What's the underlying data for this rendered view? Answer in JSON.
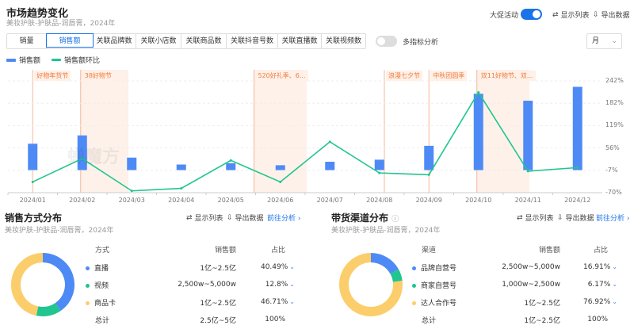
{
  "header": {
    "title": "市场趋势变化",
    "subtitle": "美妆护肤-护肤品-润唇膏，2024年",
    "promo_toggle_label": "大促活动",
    "promo_on": true,
    "show_list": "显示列表",
    "export": "导出数据"
  },
  "tabs": [
    {
      "label": "销量",
      "active": false
    },
    {
      "label": "销售额",
      "active": true
    },
    {
      "label": "关联品牌数",
      "active": false
    },
    {
      "label": "关联小店数",
      "active": false
    },
    {
      "label": "关联商品数",
      "active": false
    },
    {
      "label": "关联抖音号数",
      "active": false
    },
    {
      "label": "关联直播数",
      "active": false
    },
    {
      "label": "关联视频数",
      "active": false
    }
  ],
  "multi_metric": {
    "label": "多指标分析",
    "on": false
  },
  "period_select": "月",
  "watermark": "蝉魔方",
  "chart_data": {
    "type": "bar+line",
    "x": [
      "2024/01",
      "2024/02",
      "2024/03",
      "2024/04",
      "2024/05",
      "2024/06",
      "2024/07",
      "2024/08",
      "2024/09",
      "2024/10",
      "2024/11",
      "2024/12"
    ],
    "series": [
      {
        "name": "销售额",
        "type": "bar",
        "values": [
          0.38,
          0.5,
          0.18,
          0.08,
          0.1,
          0.07,
          0.12,
          0.15,
          0.35,
          1.1,
          1.0,
          1.2
        ],
        "color": "#4e8af6"
      },
      {
        "name": "销售额环比",
        "type": "line",
        "values": [
          -40,
          25,
          -65,
          -58,
          20,
          -40,
          72,
          -15,
          -20,
          210,
          -10,
          0
        ],
        "color": "#20c58f"
      }
    ],
    "y2_ticks": [
      "242%",
      "182%",
      "119%",
      "56%",
      "-7%",
      "-70%"
    ],
    "y2lim": [
      -70,
      242
    ],
    "events": [
      {
        "label": "好物年货节",
        "start": 0,
        "end": 0
      },
      {
        "label": "38好物节",
        "start": 1,
        "end": 1.9
      },
      {
        "label": "520好礼季、6...",
        "start": 4.5,
        "end": 5.5
      },
      {
        "label": "浪漫七夕节",
        "start": 7.1,
        "end": 7.1
      },
      {
        "label": "中秋团圆季",
        "start": 8,
        "end": 8
      },
      {
        "label": "双11好物节、双...",
        "start": 9,
        "end": 10
      }
    ],
    "grid": true
  },
  "left": {
    "title": "销售方式分布",
    "subtitle": "美妆护肤-护肤品-润唇膏，2024年",
    "show_list": "显示列表",
    "export": "导出数据",
    "goto": "前往分析",
    "headers": [
      "方式",
      "销售额",
      "占比"
    ],
    "rows": [
      {
        "name": "直播",
        "sales": "1亿~2.5亿",
        "pct": "40.49%",
        "color": "#4e8af6",
        "value": 40.49
      },
      {
        "name": "视频",
        "sales": "2,500w~5,000w",
        "pct": "12.8%",
        "color": "#20c58f",
        "value": 12.8
      },
      {
        "name": "商品卡",
        "sales": "1亿~2.5亿",
        "pct": "46.71%",
        "color": "#fbce6b",
        "value": 46.71
      }
    ],
    "total": {
      "name": "总计",
      "sales": "2.5亿~5亿",
      "pct": "100%"
    }
  },
  "right": {
    "title": "带货渠道分布",
    "subtitle": "美妆护肤-护肤品-润唇膏，2024年",
    "show_list": "显示列表",
    "export": "导出数据",
    "goto": "前往分析",
    "headers": [
      "渠道",
      "销售额",
      "占比"
    ],
    "rows": [
      {
        "name": "品牌自营号",
        "sales": "2,500w~5,000w",
        "pct": "16.91%",
        "color": "#4e8af6",
        "value": 16.91
      },
      {
        "name": "商家自营号",
        "sales": "1,000w~2,500w",
        "pct": "6.17%",
        "color": "#20c58f",
        "value": 6.17
      },
      {
        "name": "达人合作号",
        "sales": "1亿~2.5亿",
        "pct": "76.92%",
        "color": "#fbce6b",
        "value": 76.92
      }
    ],
    "total": {
      "name": "总计",
      "sales": "1亿~2.5亿",
      "pct": "100%"
    }
  }
}
